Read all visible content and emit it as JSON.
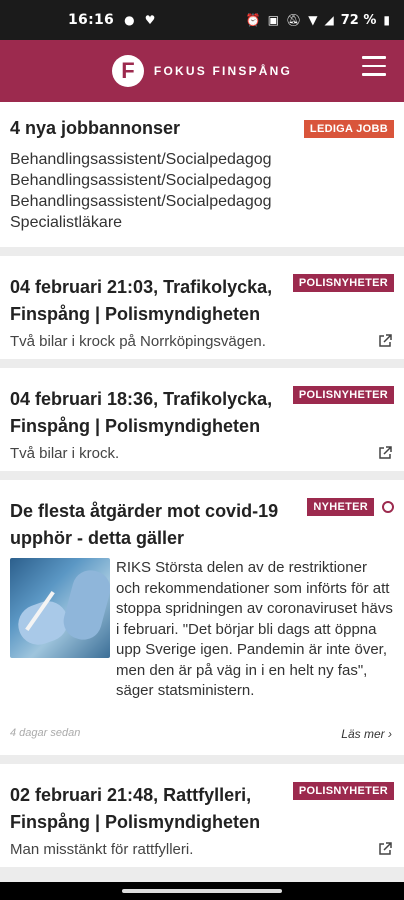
{
  "statusbar": {
    "time": "16:16",
    "battery": "72 %"
  },
  "appbar": {
    "logo_letter": "F",
    "logo_text": "FOKUS FINSPÅNG"
  },
  "jobs": {
    "title": "4 nya jobbannonser",
    "badge": "LEDIGA JOBB",
    "items": [
      "Behandlingsassistent/Socialpedagog",
      "Behandlingsassistent/Socialpedagog",
      "Behandlingsassistent/Socialpedagog",
      "Specialistläkare"
    ]
  },
  "feed": [
    {
      "title": "04 februari 21:03, Trafikolycka, Finspång | Polismyndigheten",
      "badge": "POLISNYHETER",
      "desc": "Två bilar i krock på Norrköpingsvägen."
    },
    {
      "title": "04 februari 18:36, Trafikolycka, Finspång | Polismyndigheten",
      "badge": "POLISNYHETER",
      "desc": "Två bilar i krock."
    }
  ],
  "news": {
    "title": "De flesta åtgärder mot covid-19 upphör - detta gäller",
    "badge": "NYHETER",
    "text": "RIKS Största delen av de restriktioner och rekommendationer som införts för att stoppa spridningen av coronaviruset hävs i februari. \"Det börjar bli dags att öppna upp Sverige igen. Pandemin är inte över, men den är på väg in i en helt ny fas\", säger statsministern.",
    "age": "4 dagar sedan",
    "more": "Läs mer"
  },
  "feed2": [
    {
      "title": "02 februari 21:48, Rattfylleri, Finspång | Polismyndigheten",
      "badge": "POLISNYHETER",
      "desc": "Man misstänkt för rattfylleri."
    }
  ]
}
